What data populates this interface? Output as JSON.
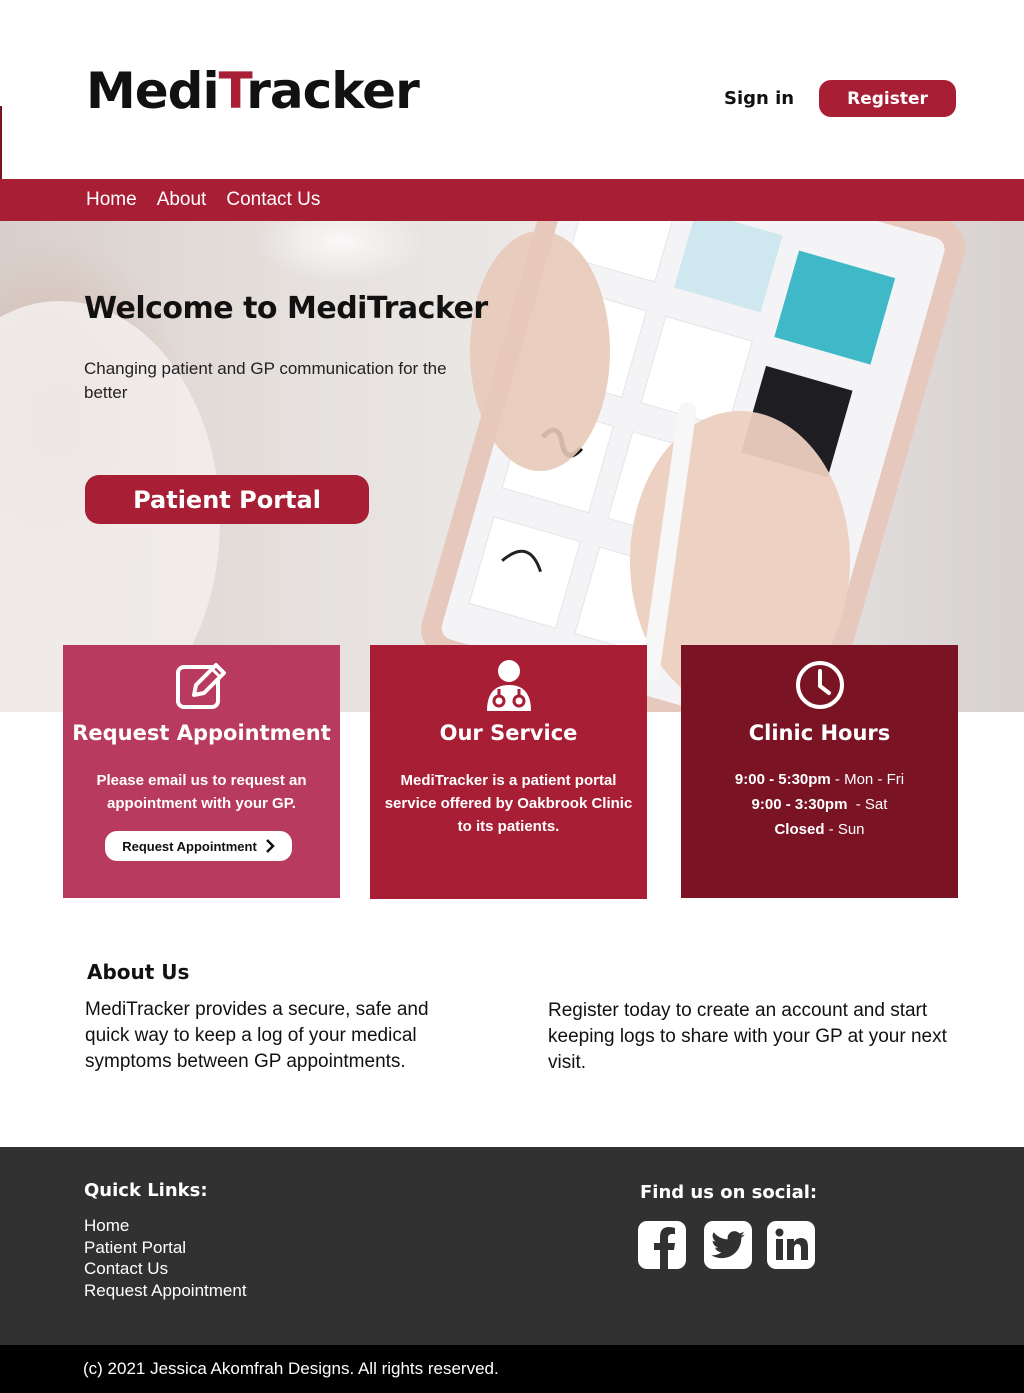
{
  "header": {
    "logo_part1": "Medi",
    "logo_part2": "T",
    "logo_part3": "racker",
    "signin_label": "Sign in",
    "register_label": "Register"
  },
  "nav": {
    "items": [
      {
        "label": "Home"
      },
      {
        "label": "About"
      },
      {
        "label": "Contact Us"
      }
    ]
  },
  "hero": {
    "title": "Welcome to MediTracker",
    "subtitle": "Changing patient and GP communication for the better",
    "cta_label": "Patient Portal"
  },
  "cards": [
    {
      "title": "Request Appointment",
      "text": "Please email us to request an appointment with your GP.",
      "button_label": "Request Appointment",
      "icon": "edit-icon",
      "color": "#b83a5e"
    },
    {
      "title": "Our Service",
      "text": "MediTracker is a patient portal service offered by Oakbrook Clinic to its patients.",
      "icon": "doctor-icon",
      "color": "#a81e34"
    },
    {
      "title": "Clinic Hours",
      "icon": "clock-icon",
      "color": "#7a1424",
      "hours": [
        {
          "time": "9:00 - 5:30pm",
          "days": " - Mon - Fri"
        },
        {
          "time": "9:00 - 3:30pm",
          "days": "  - Sat"
        },
        {
          "time": "Closed",
          "days": " - Sun"
        }
      ]
    }
  ],
  "about": {
    "title": "About Us",
    "left": "MediTracker provides a secure, safe and quick way to keep a log of your medical symptoms between GP appointments.",
    "right": "Register today to create an account and start keeping logs to share with your GP at your next visit."
  },
  "footer": {
    "quick_links_title": "Quick Links:",
    "quick_links": [
      "Home",
      "Patient Portal",
      "Contact Us",
      "Request Appointment"
    ],
    "social_title": "Find us on social:",
    "social_icons": [
      "facebook-icon",
      "twitter-icon",
      "linkedin-icon"
    ],
    "copyright": "(c) 2021 Jessica Akomfrah Designs. All rights reserved."
  },
  "colors": {
    "brand": "#a81e34",
    "card_pink": "#b83a5e",
    "card_dark": "#7a1424",
    "footer_bg": "#313131"
  }
}
